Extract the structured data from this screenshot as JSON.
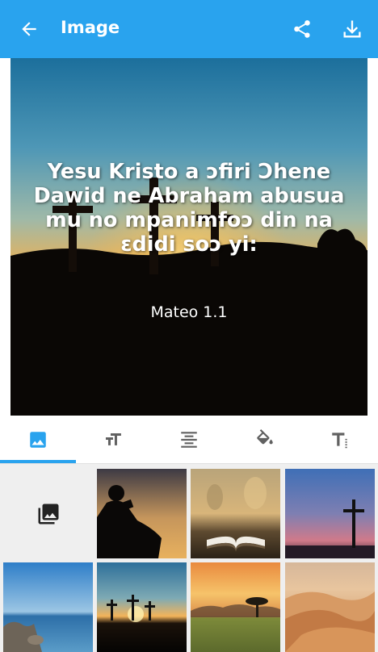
{
  "appbar": {
    "title": "Image",
    "back_icon": "arrow-back-icon",
    "share_icon": "share-icon",
    "download_icon": "download-icon",
    "color": "#29a3ee"
  },
  "preview": {
    "verse": "Yesu Kristo a ɔfiri Ɔhene Dawid ne Abraham abusua mu no mpanimfoɔ din na ɛdidi soɔ yi:",
    "reference": "Mateo 1.1",
    "background": "sunset-crosses"
  },
  "tabs": [
    {
      "name": "background-image",
      "icon": "image-icon",
      "selected": true
    },
    {
      "name": "font",
      "icon": "font-size-icon",
      "selected": false
    },
    {
      "name": "alignment",
      "icon": "align-center-icon",
      "selected": false
    },
    {
      "name": "color",
      "icon": "paint-bucket-icon",
      "selected": false
    },
    {
      "name": "text-format",
      "icon": "text-format-icon",
      "selected": false
    }
  ],
  "gallery": {
    "picker_icon": "photo-library-icon",
    "thumbnails": [
      {
        "name": "reading-silhouette"
      },
      {
        "name": "open-bible"
      },
      {
        "name": "cross-dusk"
      },
      {
        "name": "sea-rocks"
      },
      {
        "name": "three-crosses"
      },
      {
        "name": "savanna-tree"
      },
      {
        "name": "desert-dunes"
      }
    ]
  }
}
